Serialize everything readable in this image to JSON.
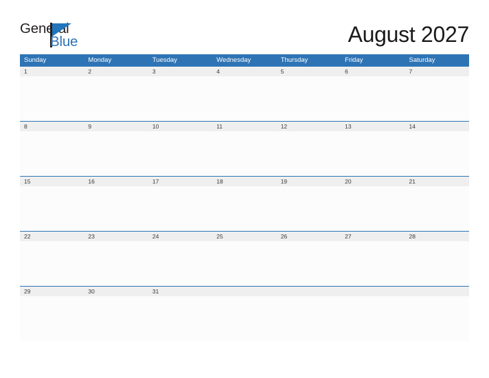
{
  "brand": {
    "logo_text_top": "General",
    "logo_text_bottom": "Blue",
    "logo_icon": "blue-triangle-flag-icon",
    "accent_color": "#2e74b5",
    "dark_color": "#231f20"
  },
  "header": {
    "title": "August 2027"
  },
  "calendar": {
    "month": "August",
    "year": "2027",
    "header_background": "#2e74b5",
    "date_band_background": "#efefef",
    "cell_background": "#fcfcfc",
    "weekdays": [
      "Sunday",
      "Monday",
      "Tuesday",
      "Wednesday",
      "Thursday",
      "Friday",
      "Saturday"
    ],
    "weeks": [
      [
        "1",
        "2",
        "3",
        "4",
        "5",
        "6",
        "7"
      ],
      [
        "8",
        "9",
        "10",
        "11",
        "12",
        "13",
        "14"
      ],
      [
        "15",
        "16",
        "17",
        "18",
        "19",
        "20",
        "21"
      ],
      [
        "22",
        "23",
        "24",
        "25",
        "26",
        "27",
        "28"
      ],
      [
        "29",
        "30",
        "31",
        "",
        "",
        "",
        ""
      ]
    ]
  }
}
